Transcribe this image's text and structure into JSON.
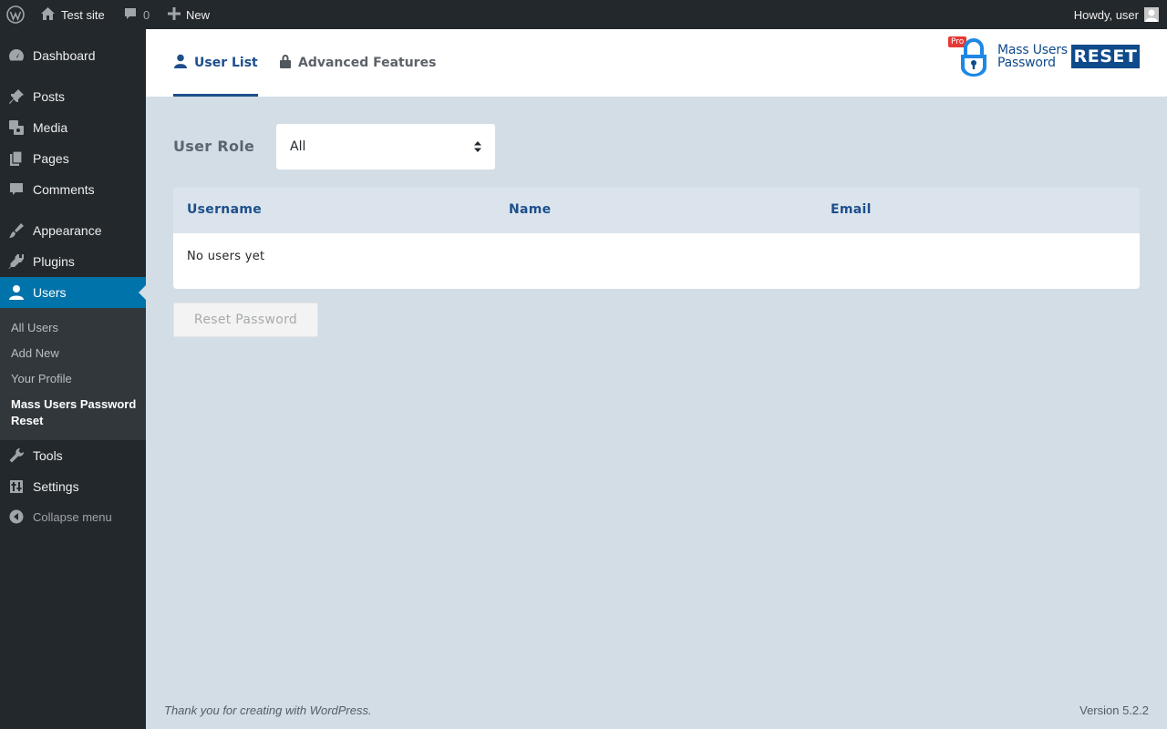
{
  "admin_bar": {
    "site_name": "Test site",
    "comments_count": "0",
    "new_label": "New",
    "greeting": "Howdy, user"
  },
  "sidebar": {
    "items": [
      {
        "label": "Dashboard",
        "icon": "dashboard-icon"
      },
      {
        "label": "Posts",
        "icon": "pin-icon"
      },
      {
        "label": "Media",
        "icon": "media-icon"
      },
      {
        "label": "Pages",
        "icon": "pages-icon"
      },
      {
        "label": "Comments",
        "icon": "comment-icon"
      },
      {
        "label": "Appearance",
        "icon": "brush-icon"
      },
      {
        "label": "Plugins",
        "icon": "plugin-icon"
      },
      {
        "label": "Users",
        "icon": "user-icon",
        "active": true
      },
      {
        "label": "Tools",
        "icon": "wrench-icon"
      },
      {
        "label": "Settings",
        "icon": "settings-icon"
      }
    ],
    "submenu": [
      "All Users",
      "Add New",
      "Your Profile",
      "Mass Users Password Reset"
    ],
    "collapse_label": "Collapse menu"
  },
  "plugin": {
    "tabs": [
      {
        "label": "User List",
        "icon": "user-icon",
        "active": true
      },
      {
        "label": "Advanced Features",
        "icon": "lock-icon"
      }
    ],
    "logo": {
      "badge": "Pro",
      "line1": "Mass Users",
      "line2": "Password",
      "reset": "RESET"
    }
  },
  "filter": {
    "label": "User Role",
    "selected": "All"
  },
  "table": {
    "columns": [
      "Username",
      "Name",
      "Email"
    ],
    "empty_message": "No users yet"
  },
  "actions": {
    "reset_label": "Reset Password"
  },
  "footer": {
    "left": "Thank you for creating with WordPress.",
    "version": "Version 5.2.2"
  },
  "colors": {
    "admin_dark": "#23282d",
    "active_blue": "#0073aa",
    "page_bg": "#d3dde5",
    "plugin_blue": "#1d4f8c"
  }
}
